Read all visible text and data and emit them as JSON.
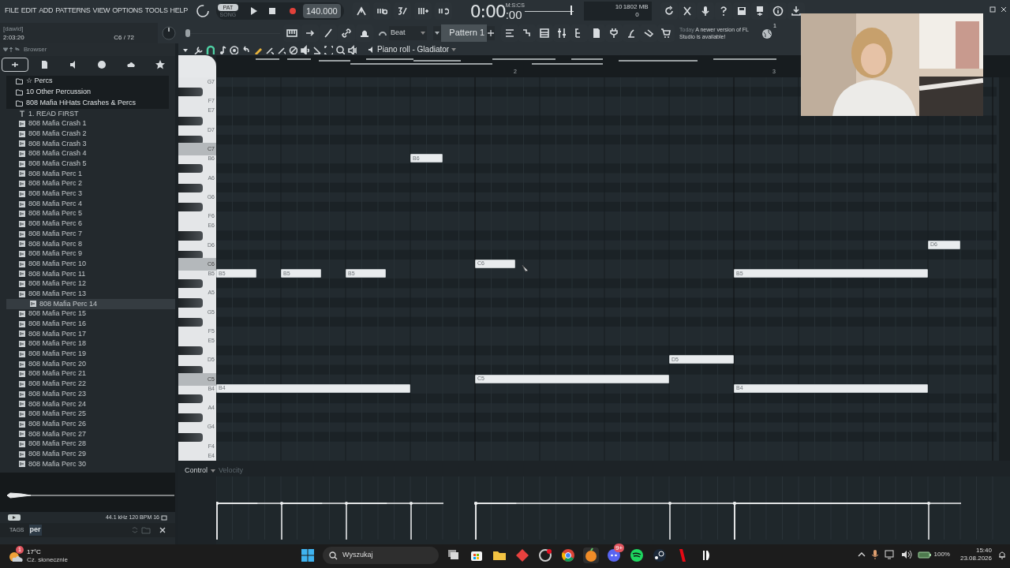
{
  "menu": [
    "FILE",
    "EDIT",
    "ADD",
    "PATTERNS",
    "VIEW",
    "OPTIONS",
    "TOOLS",
    "HELP"
  ],
  "transport": {
    "pat_label": "PAT",
    "song_label": "SONG",
    "song_mode": false,
    "tempo": "140.000"
  },
  "time": {
    "main": "0:00",
    "fraction": ":00",
    "unit": "M:S:CS"
  },
  "position_slider": {
    "level": 0.97
  },
  "pitch_slider": {
    "level": 0
  },
  "cpu": {
    "value": "10",
    "memory": "1802 MB",
    "voices": "0"
  },
  "hint": {
    "user": "[dawid]",
    "time": "2:03:20",
    "note": "C6 / 72"
  },
  "snap": "Beat",
  "pattern": "Pattern 1",
  "news": {
    "date": "Today",
    "message": "A newer version of FL Studio is available!",
    "count": "1"
  },
  "browser": {
    "title": "Browser",
    "tabs": [
      {
        "selected": true
      },
      {
        "selected": false
      },
      {
        "selected": false
      },
      {
        "selected": false
      },
      {
        "selected": false
      },
      {
        "selected": false
      }
    ],
    "items": [
      {
        "kind": "folder",
        "label": "☆ Percs",
        "selected": false
      },
      {
        "kind": "folder",
        "label": "10 Other Percussion",
        "selected": false
      },
      {
        "kind": "folder",
        "label": "808 Mafia HiHats Crashes & Percs",
        "selected": false
      },
      {
        "kind": "text",
        "label": "1. READ FIRST",
        "selected": false
      },
      {
        "kind": "audio",
        "label": "808 Mafia Crash 1",
        "selected": false
      },
      {
        "kind": "audio",
        "label": "808 Mafia Crash 2",
        "selected": false
      },
      {
        "kind": "audio",
        "label": "808 Mafia Crash 3",
        "selected": false
      },
      {
        "kind": "audio",
        "label": "808 Mafia Crash 4",
        "selected": false
      },
      {
        "kind": "audio",
        "label": "808 Mafia Crash 5",
        "selected": false
      },
      {
        "kind": "audio",
        "label": "808 Mafia Perc 1",
        "selected": false
      },
      {
        "kind": "audio",
        "label": "808 Mafia Perc 2",
        "selected": false
      },
      {
        "kind": "audio",
        "label": "808 Mafia Perc 3",
        "selected": false
      },
      {
        "kind": "audio",
        "label": "808 Mafia Perc 4",
        "selected": false
      },
      {
        "kind": "audio",
        "label": "808 Mafia Perc 5",
        "selected": false
      },
      {
        "kind": "audio",
        "label": "808 Mafia Perc 6",
        "selected": false
      },
      {
        "kind": "audio",
        "label": "808 Mafia Perc 7",
        "selected": false
      },
      {
        "kind": "audio",
        "label": "808 Mafia Perc 8",
        "selected": false
      },
      {
        "kind": "audio",
        "label": "808 Mafia Perc 9",
        "selected": false
      },
      {
        "kind": "audio",
        "label": "808 Mafia Perc 10",
        "selected": false
      },
      {
        "kind": "audio",
        "label": "808 Mafia Perc 11",
        "selected": false
      },
      {
        "kind": "audio",
        "label": "808 Mafia Perc 12",
        "selected": false
      },
      {
        "kind": "audio",
        "label": "808 Mafia Perc 13",
        "selected": false
      },
      {
        "kind": "audio",
        "label": "808 Mafia Perc 14",
        "selected": true
      },
      {
        "kind": "audio",
        "label": "808 Mafia Perc 15",
        "selected": false
      },
      {
        "kind": "audio",
        "label": "808 Mafia Perc 16",
        "selected": false
      },
      {
        "kind": "audio",
        "label": "808 Mafia Perc 17",
        "selected": false
      },
      {
        "kind": "audio",
        "label": "808 Mafia Perc 18",
        "selected": false
      },
      {
        "kind": "audio",
        "label": "808 Mafia Perc 19",
        "selected": false
      },
      {
        "kind": "audio",
        "label": "808 Mafia Perc 20",
        "selected": false
      },
      {
        "kind": "audio",
        "label": "808 Mafia Perc 21",
        "selected": false
      },
      {
        "kind": "audio",
        "label": "808 Mafia Perc 22",
        "selected": false
      },
      {
        "kind": "audio",
        "label": "808 Mafia Perc 23",
        "selected": false
      },
      {
        "kind": "audio",
        "label": "808 Mafia Perc 24",
        "selected": false
      },
      {
        "kind": "audio",
        "label": "808 Mafia Perc 25",
        "selected": false
      },
      {
        "kind": "audio",
        "label": "808 Mafia Perc 26",
        "selected": false
      },
      {
        "kind": "audio",
        "label": "808 Mafia Perc 27",
        "selected": false
      },
      {
        "kind": "audio",
        "label": "808 Mafia Perc 28",
        "selected": false
      },
      {
        "kind": "audio",
        "label": "808 Mafia Perc 29",
        "selected": false
      },
      {
        "kind": "audio",
        "label": "808 Mafia Perc 30",
        "selected": false
      }
    ],
    "sample_info": "44.1 kHz 120 BPM 16",
    "tags_label": "TAGS",
    "tags_value": "per"
  },
  "piano_roll": {
    "title": "Piano roll - Gladiator",
    "bar_labels": [
      "2",
      "3"
    ],
    "keys": [
      {
        "kind": "white",
        "label": "G7"
      },
      {
        "kind": "black"
      },
      {
        "kind": "white",
        "label": "F7"
      },
      {
        "kind": "white",
        "label": "E7"
      },
      {
        "kind": "black"
      },
      {
        "kind": "white",
        "label": "D7"
      },
      {
        "kind": "black"
      },
      {
        "kind": "c",
        "label": "C7"
      },
      {
        "kind": "white",
        "label": "B6"
      },
      {
        "kind": "black"
      },
      {
        "kind": "white",
        "label": "A6"
      },
      {
        "kind": "black"
      },
      {
        "kind": "white",
        "label": "G6"
      },
      {
        "kind": "black"
      },
      {
        "kind": "white",
        "label": "F6"
      },
      {
        "kind": "white",
        "label": "E6"
      },
      {
        "kind": "black"
      },
      {
        "kind": "white",
        "label": "D6"
      },
      {
        "kind": "black"
      },
      {
        "kind": "c",
        "label": "C6"
      },
      {
        "kind": "white",
        "label": "B5"
      },
      {
        "kind": "black"
      },
      {
        "kind": "white",
        "label": "A5"
      },
      {
        "kind": "black"
      },
      {
        "kind": "white",
        "label": "G5"
      },
      {
        "kind": "black"
      },
      {
        "kind": "white",
        "label": "F5"
      },
      {
        "kind": "white",
        "label": "E5"
      },
      {
        "kind": "black"
      },
      {
        "kind": "white",
        "label": "D5"
      },
      {
        "kind": "black"
      },
      {
        "kind": "c",
        "label": "C5"
      },
      {
        "kind": "white",
        "label": "B4"
      },
      {
        "kind": "black"
      },
      {
        "kind": "white",
        "label": "A4"
      },
      {
        "kind": "black"
      },
      {
        "kind": "white",
        "label": "G4"
      },
      {
        "kind": "black"
      },
      {
        "kind": "white",
        "label": "F4"
      },
      {
        "kind": "white",
        "label": "E4"
      }
    ],
    "notes": [
      {
        "label": "B6"
      },
      {
        "label": "C6"
      },
      {
        "label": "B5"
      },
      {
        "label": "B5"
      },
      {
        "label": "B5"
      },
      {
        "label": "B5"
      },
      {
        "label": "D6"
      },
      {
        "label": "D5"
      },
      {
        "label": "C5"
      },
      {
        "label": "B4"
      },
      {
        "label": "B4"
      }
    ],
    "control_label": "Control",
    "lane_label": "Velocity"
  },
  "taskbar": {
    "temperature": "17°C",
    "weather": "Cz. słonecznie",
    "weather_badge": "1",
    "search": "Wyszukaj",
    "chat_badge": "9+",
    "battery": "100%",
    "clock": "15:40",
    "date": "23.08.2026"
  }
}
